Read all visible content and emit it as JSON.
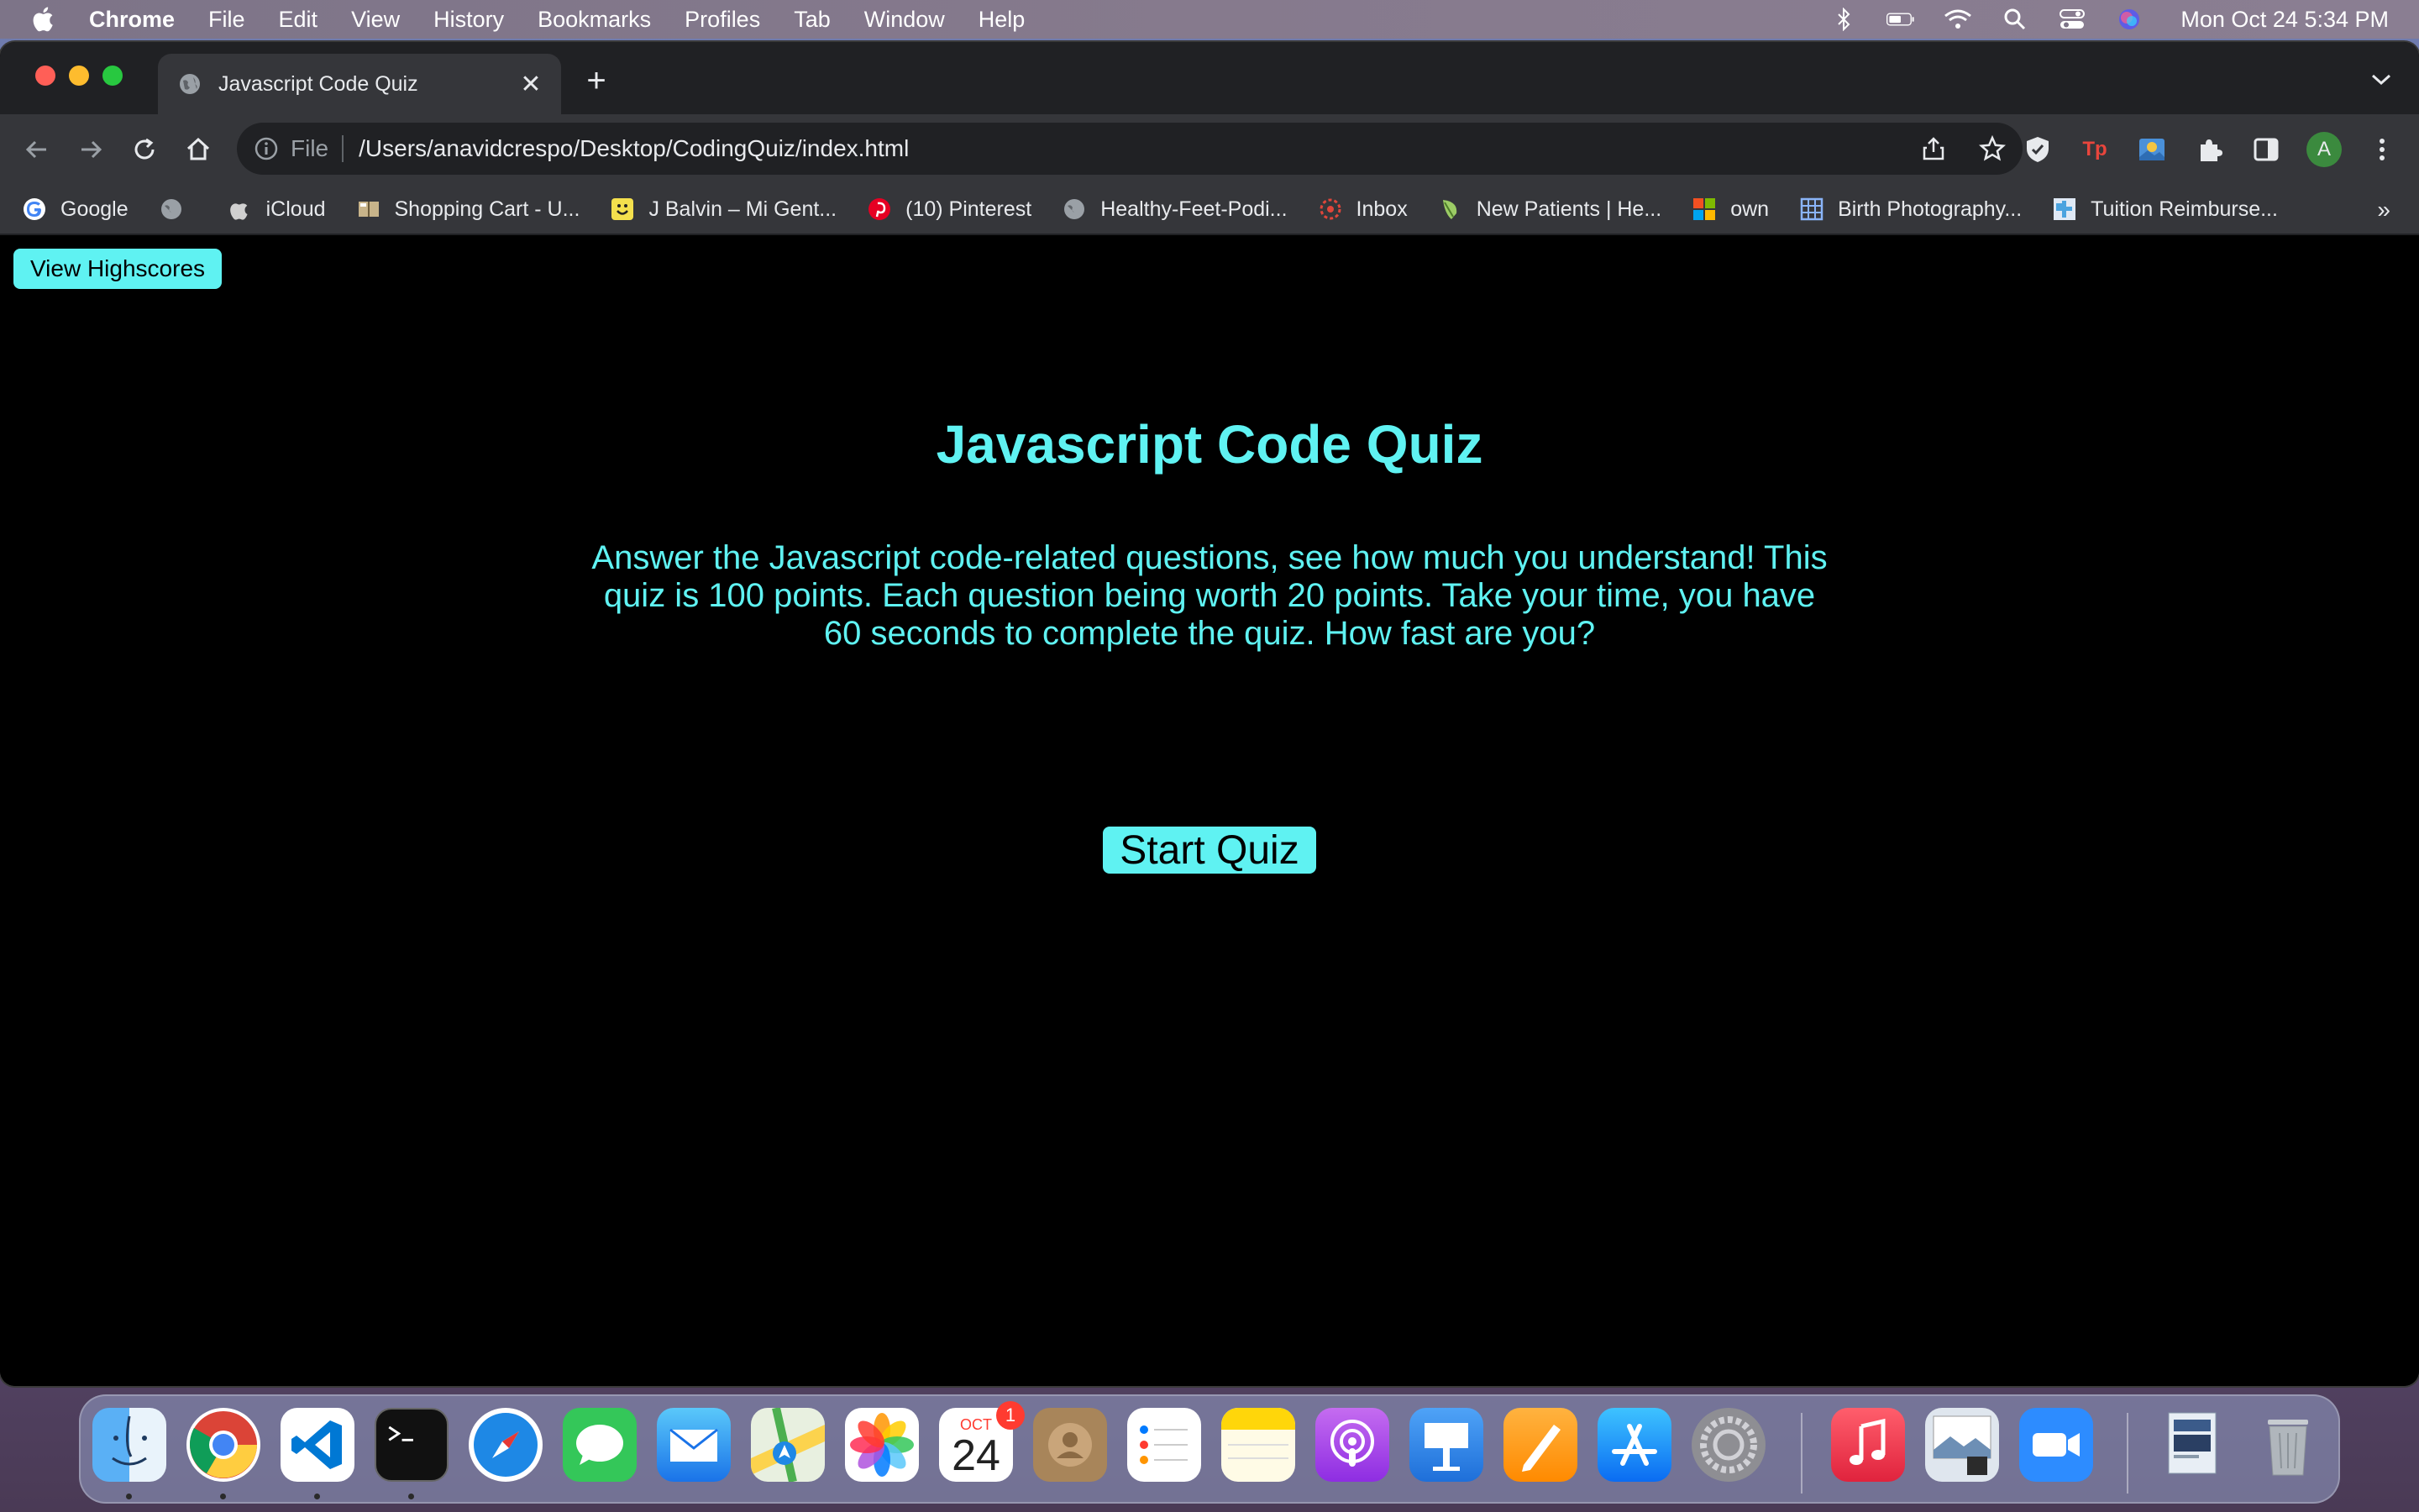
{
  "menubar": {
    "app_name": "Chrome",
    "items": [
      "File",
      "Edit",
      "View",
      "History",
      "Bookmarks",
      "Profiles",
      "Tab",
      "Window",
      "Help"
    ],
    "clock": "Mon Oct 24  5:34 PM"
  },
  "browser": {
    "tab_title": "Javascript Code Quiz",
    "tab_close": "✕",
    "new_tab": "+",
    "omnibox_scheme": "File",
    "url": "/Users/anavidcrespo/Desktop/CodingQuiz/index.html",
    "avatar_letter": "A",
    "ext_tp": "Tp",
    "bookmarks": [
      {
        "label": "Google",
        "icon": "google-icon",
        "color": "#ffffff"
      },
      {
        "label": "",
        "icon": "globe-icon",
        "color": "#9aa0a6"
      },
      {
        "label": "iCloud",
        "icon": "apple-icon",
        "color": "#d0d0d0"
      },
      {
        "label": "Shopping Cart - U...",
        "icon": "book-icon",
        "color": "#c8b48a"
      },
      {
        "label": "J Balvin – Mi Gent...",
        "icon": "smiley-icon",
        "color": "#f4e04d"
      },
      {
        "label": "(10) Pinterest",
        "icon": "pinterest-icon",
        "color": "#e60023"
      },
      {
        "label": "Healthy-Feet-Podi...",
        "icon": "globe-icon",
        "color": "#9aa0a6"
      },
      {
        "label": "Inbox",
        "icon": "inbox-icon",
        "color": "#e0463a"
      },
      {
        "label": "New Patients | He...",
        "icon": "leaf-icon",
        "color": "#9ccc65"
      },
      {
        "label": "own",
        "icon": "microsoft-icon",
        "color": "#f25022"
      },
      {
        "label": "Birth Photography...",
        "icon": "grid-icon",
        "color": "#8ab4f8"
      },
      {
        "label": "Tuition Reimburse...",
        "icon": "puzzle-icon",
        "color": "#4aa3df"
      }
    ],
    "bookmarks_overflow": "»"
  },
  "page": {
    "highscores_label": "View Highscores",
    "title": "Javascript Code Quiz",
    "description": "Answer the Javascript code-related questions, see how much you understand! This quiz is 100 points. Each question being worth 20 points. Take your time, you have 60 seconds to complete the quiz. How fast are you?",
    "start_label": "Start Quiz"
  },
  "dock": {
    "calendar_month": "OCT",
    "calendar_day": "24",
    "calendar_badge": "1"
  },
  "colors": {
    "accent": "#5ff2f2",
    "page_bg": "#000000",
    "chrome_dark": "#202124",
    "chrome_toolbar": "#35363a"
  }
}
